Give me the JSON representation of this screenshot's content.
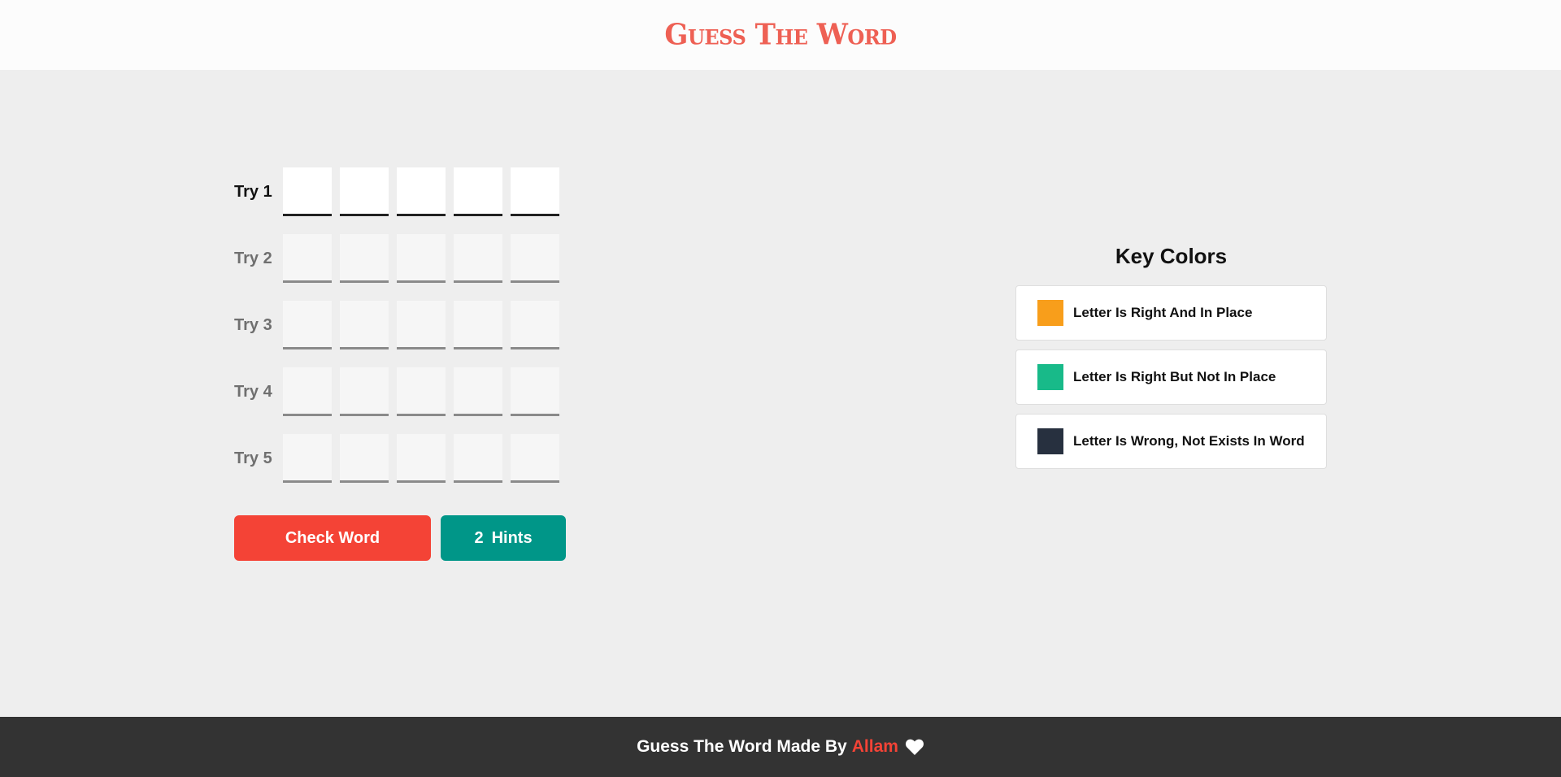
{
  "header": {
    "title": "Guess The Word"
  },
  "game": {
    "tries": [
      {
        "label": "Try 1",
        "active": true,
        "letters": [
          "",
          "",
          "",
          "",
          ""
        ]
      },
      {
        "label": "Try 2",
        "active": false,
        "letters": [
          "",
          "",
          "",
          "",
          ""
        ]
      },
      {
        "label": "Try 3",
        "active": false,
        "letters": [
          "",
          "",
          "",
          "",
          ""
        ]
      },
      {
        "label": "Try 4",
        "active": false,
        "letters": [
          "",
          "",
          "",
          "",
          ""
        ]
      },
      {
        "label": "Try 5",
        "active": false,
        "letters": [
          "",
          "",
          "",
          "",
          ""
        ]
      }
    ],
    "check_label": "Check Word",
    "hint_count": "2",
    "hint_label": "Hints"
  },
  "key_colors": {
    "title": "Key Colors",
    "items": [
      {
        "text": "Letter Is Right And In Place",
        "color": "#f89e1b"
      },
      {
        "text": "Letter Is Right But Not In Place",
        "color": "#18ba89"
      },
      {
        "text": "Letter Is Wrong, Not Exists In Word",
        "color": "#27303f"
      }
    ]
  },
  "footer": {
    "text": "Guess The Word Made By",
    "author": "Allam",
    "icon": "heart-icon"
  },
  "colors": {
    "accent": "#f44336",
    "hint": "#009688",
    "logo": "#ee6054",
    "footer_bg": "#333333"
  }
}
